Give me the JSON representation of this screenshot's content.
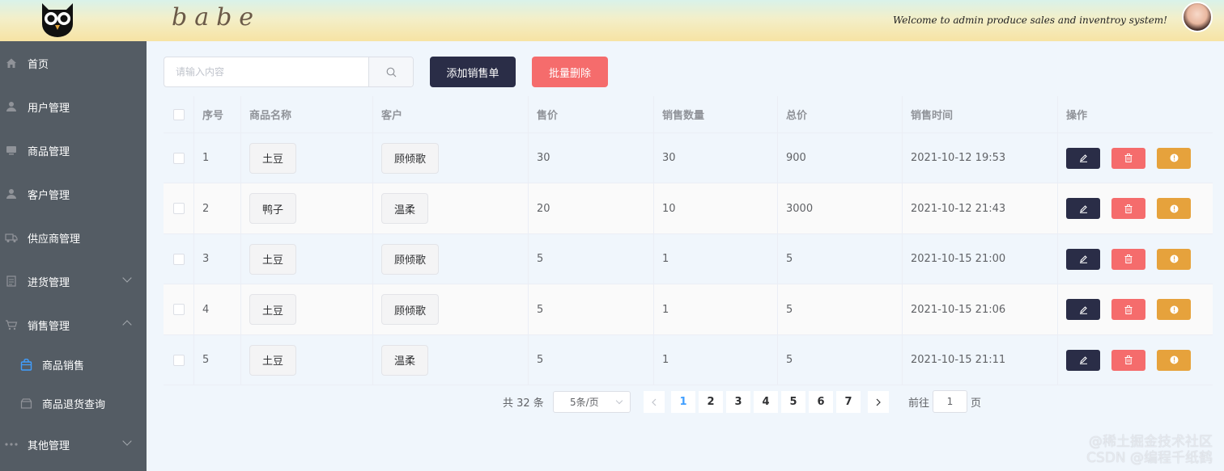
{
  "header": {
    "brand": "babe",
    "welcome": "Welcome to admin produce sales and inventroy system!"
  },
  "sidebar": {
    "items": [
      {
        "label": "首页",
        "icon": "home-icon"
      },
      {
        "label": "用户管理",
        "icon": "user-icon"
      },
      {
        "label": "商品管理",
        "icon": "monitor-icon"
      },
      {
        "label": "客户管理",
        "icon": "user-icon"
      },
      {
        "label": "供应商管理",
        "icon": "truck-icon"
      },
      {
        "label": "进货管理",
        "icon": "document-icon"
      },
      {
        "label": "销售管理",
        "icon": "cart-icon"
      },
      {
        "label": "其他管理",
        "icon": "more-icon"
      }
    ],
    "sub_items": [
      {
        "label": "商品销售",
        "icon": "bag-icon"
      },
      {
        "label": "商品退货查询",
        "icon": "box-icon"
      }
    ]
  },
  "toolbar": {
    "search_placeholder": "请输入内容",
    "add_label": "添加销售单",
    "batch_delete_label": "批量删除"
  },
  "table": {
    "headers": [
      "序号",
      "商品名称",
      "客户",
      "售价",
      "销售数量",
      "总价",
      "销售时间",
      "操作"
    ],
    "rows": [
      {
        "id": "1",
        "product": "土豆",
        "customer": "顾倾歌",
        "price": "30",
        "qty": "30",
        "total": "900",
        "time": "2021-10-12 19:53"
      },
      {
        "id": "2",
        "product": "鸭子",
        "customer": "温柔",
        "price": "20",
        "qty": "10",
        "total": "3000",
        "time": "2021-10-12 21:43"
      },
      {
        "id": "3",
        "product": "土豆",
        "customer": "顾倾歌",
        "price": "5",
        "qty": "1",
        "total": "5",
        "time": "2021-10-15 21:00"
      },
      {
        "id": "4",
        "product": "土豆",
        "customer": "顾倾歌",
        "price": "5",
        "qty": "1",
        "total": "5",
        "time": "2021-10-15 21:06"
      },
      {
        "id": "5",
        "product": "土豆",
        "customer": "温柔",
        "price": "5",
        "qty": "1",
        "total": "5",
        "time": "2021-10-15 21:11"
      }
    ]
  },
  "pagination": {
    "total_text": "共 32 条",
    "page_size": "5条/页",
    "pages": [
      "1",
      "2",
      "3",
      "4",
      "5",
      "6",
      "7"
    ],
    "current_page": "1",
    "goto_label": "前往",
    "goto_value": "1",
    "page_suffix": "页"
  },
  "watermark": {
    "line1": "@稀土掘金技术社区",
    "line2": "CSDN @编程千纸鹤"
  },
  "colors": {
    "sidebar_bg": "#545c64",
    "primary_dark": "#2a2d47",
    "danger": "#f56c6c",
    "warning": "#e6a23c",
    "active_page": "#409eff"
  }
}
